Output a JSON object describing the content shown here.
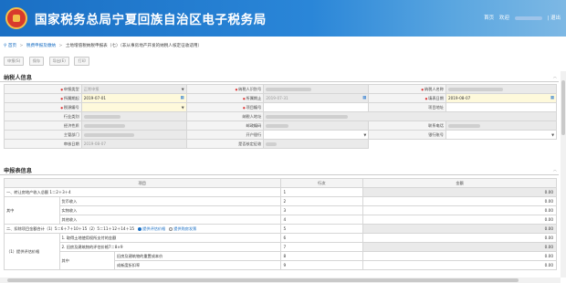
{
  "header": {
    "site_title": "国家税务总局宁夏回族自治区电子税务局",
    "user_label": "首页",
    "user_greeting": "欢迎",
    "logout": "| 退出",
    "colors": {
      "bar_start": "#1a6fc4",
      "bar_end": "#7db8e4",
      "title": "#ffffff"
    }
  },
  "breadcrumb": {
    "home": "首页",
    "level1": "税费申报及缴纳",
    "current": "土地增值税纳税申报表（七）（非从事房地产开发的纳税人核定征收适用）"
  },
  "toolbar": {
    "buttons": [
      "申报(S)",
      "保存",
      "导出(E)",
      "打印"
    ]
  },
  "taxpayer": {
    "section_title": "纳税人信息",
    "fields": {
      "declare_type": "申报类型",
      "declare_type_value": "正常申报",
      "taxpayer_id": "纳税人识别号",
      "taxpayer_name": "纳税人名称",
      "period_start": "所属期起",
      "period_start_value": "2019-07-01",
      "period_end": "所属期止",
      "period_end_value": "2019-07-31",
      "fill_date": "填表日期",
      "fill_date_value": "2019-08-07",
      "tax_item": "税源编号",
      "project_name": "项目编号",
      "project_address": "项目地址",
      "industry": "行业类别",
      "taxpayer_address": "纳税人地址",
      "economic_nature": "经济性质",
      "postcode": "邮政编码",
      "phone": "联系电话",
      "authority": "主管部门",
      "bank": "开户银行",
      "account": "银行账号",
      "audit_date": "审核日期",
      "audit_date_value": "2019-08-07",
      "approved": "是否核定征收"
    }
  },
  "declaration": {
    "section_title": "申报表信息",
    "headers": [
      "项目",
      "行次",
      "金额"
    ],
    "rows": [
      {
        "label": "一、转让房地产收入总额 1＝2＋3＋4",
        "line": "1",
        "amount": "0.00"
      },
      {
        "label": "其中",
        "sub": "货币收入",
        "line": "2",
        "amount": "0.00"
      },
      {
        "label": "",
        "sub": "实物收入",
        "line": "3",
        "amount": "0.00"
      },
      {
        "label": "",
        "sub": "其他收入",
        "line": "4",
        "amount": "0.00"
      },
      {
        "label": "二、扣除项目金额合计（1）5＝6＋7＋10＋15（2）5＝11＋12＋14＋15",
        "line": "5",
        "amount": "0.00",
        "option1": "提供评估价格",
        "option2": "提供购房发票"
      },
      {
        "label": "1. 取得土地使用权所支付的金额",
        "line": "6",
        "amount": "0.00"
      },
      {
        "label": "2. 旧房及建筑物的评估价格7＝8×9",
        "line": "7",
        "amount": "0.00"
      },
      {
        "label": "（1）提供评估价格",
        "sub": "其中",
        "sub2": "旧房及建筑物的重置成本价",
        "line": "8",
        "amount": "0.00"
      },
      {
        "label": "",
        "sub2": "成新度折扣率",
        "line": "9",
        "amount": "0.00"
      }
    ]
  }
}
